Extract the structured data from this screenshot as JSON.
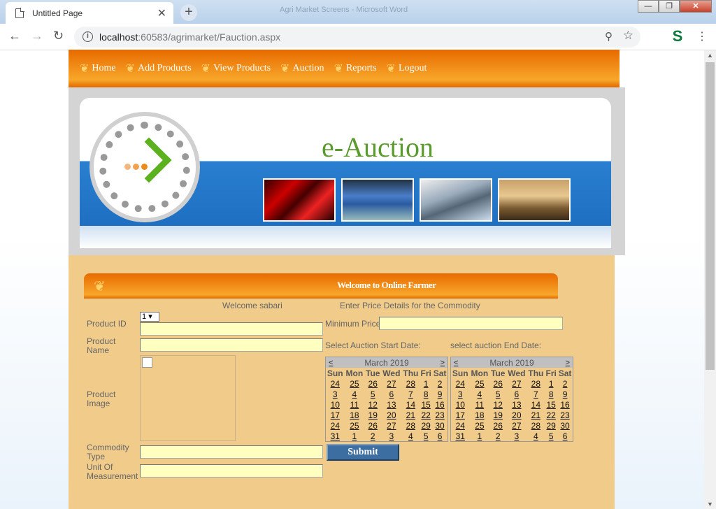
{
  "browser": {
    "tab_title": "Untitled Page",
    "window_title": "Agri Market Screens - Microsoft Word",
    "url_host": "localhost",
    "url_rest": ":60583/agrimarket/Fauction.aspx"
  },
  "nav": {
    "items": [
      "Home",
      "Add Products",
      "View Products",
      "Auction",
      "Reports",
      "Logout"
    ]
  },
  "banner": {
    "title": "e-Auction"
  },
  "welcome_bar": {
    "text": "Welcome to Online Farmer"
  },
  "form": {
    "welcome_user": "Welcome sabari",
    "price_heading": "Enter Price Details for the Commodity",
    "product_id_label": "Product ID",
    "product_id_value": "1",
    "product_name_label": "Product Name",
    "product_image_label": "Product Image",
    "commodity_type_label": "Commodity Type",
    "unit_label": "Unit Of Measurement",
    "min_price_label": "Minimum Price",
    "start_date_label": "Select Auction Start Date:",
    "end_date_label": "select auction End Date:",
    "submit_label": "Submit"
  },
  "calendar": {
    "month_title": "March 2019",
    "prev": "<",
    "next": ">",
    "days": [
      "Sun",
      "Mon",
      "Tue",
      "Wed",
      "Thu",
      "Fri",
      "Sat"
    ],
    "weeks": [
      [
        "24",
        "25",
        "26",
        "27",
        "28",
        "1",
        "2"
      ],
      [
        "3",
        "4",
        "5",
        "6",
        "7",
        "8",
        "9"
      ],
      [
        "10",
        "11",
        "12",
        "13",
        "14",
        "15",
        "16"
      ],
      [
        "17",
        "18",
        "19",
        "20",
        "21",
        "22",
        "23"
      ],
      [
        "24",
        "25",
        "26",
        "27",
        "28",
        "29",
        "30"
      ],
      [
        "31",
        "1",
        "2",
        "3",
        "4",
        "5",
        "6"
      ]
    ]
  }
}
